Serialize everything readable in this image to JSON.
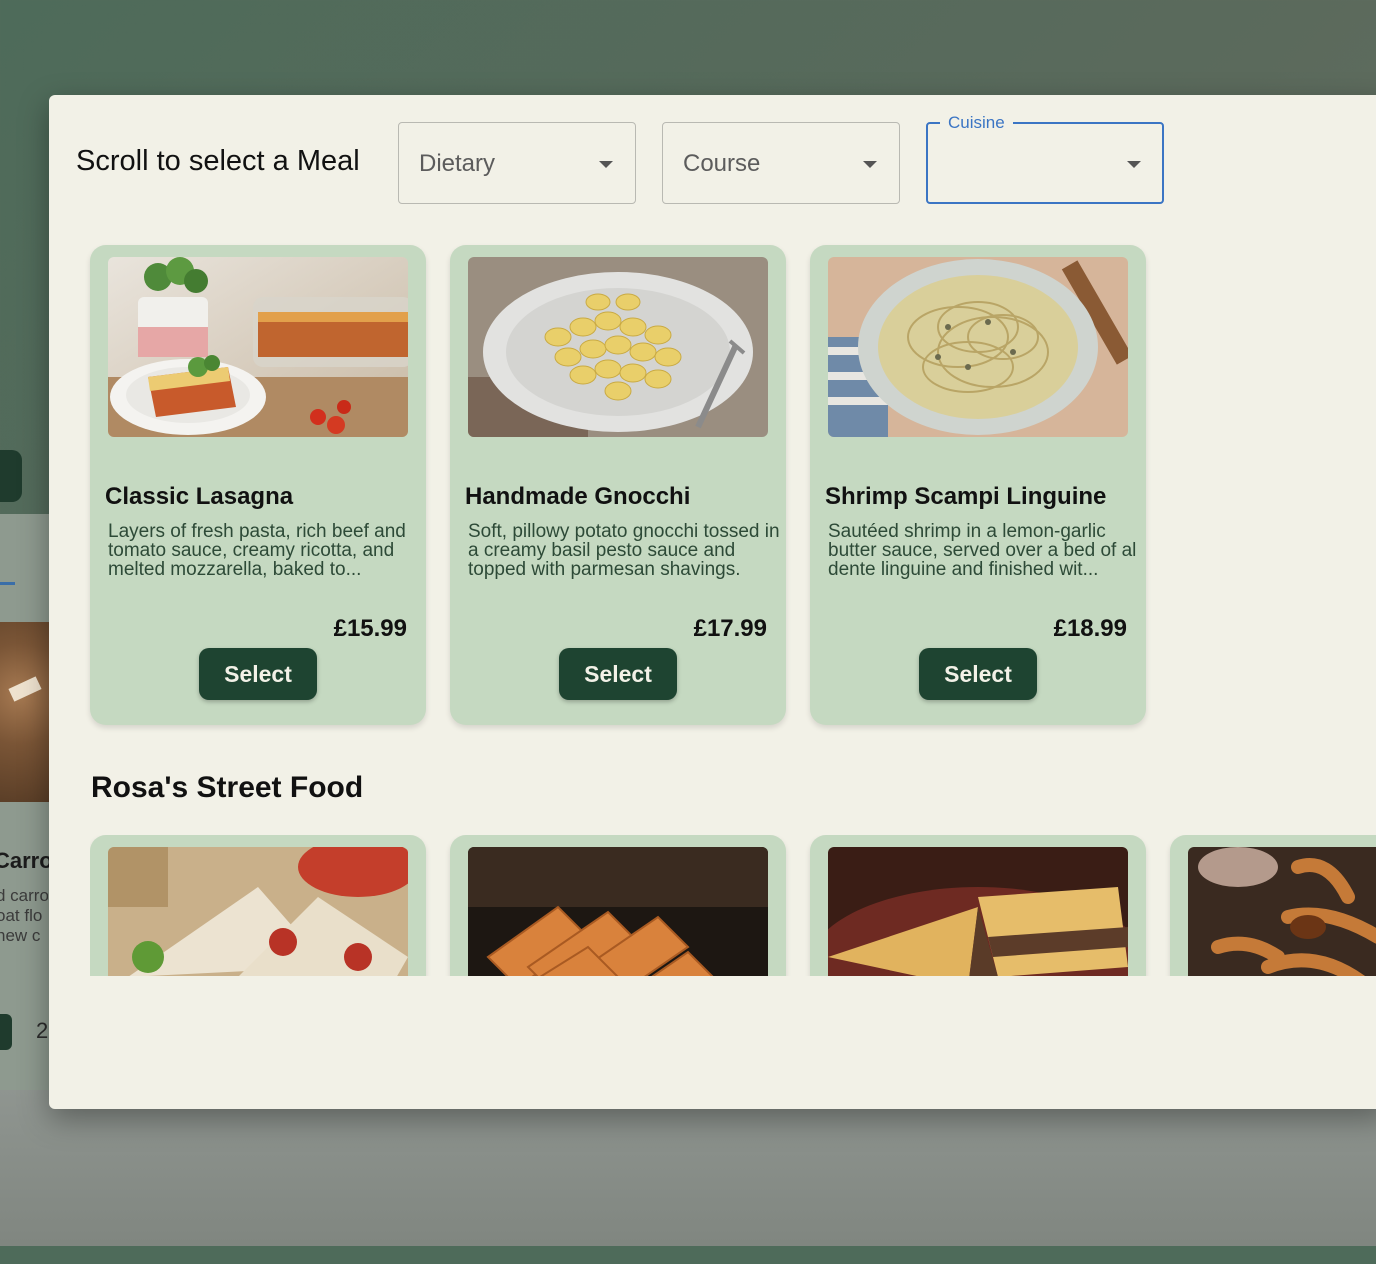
{
  "background": {
    "card_title_fragment": "Carro",
    "card_desc_lines": [
      "d carro",
      "oat flo",
      "hew c"
    ],
    "pagination_fragment": "2"
  },
  "modal": {
    "title": "Scroll to select a Meal",
    "filters": {
      "dietary": {
        "placeholder": "Dietary"
      },
      "course": {
        "placeholder": "Course"
      },
      "cuisine": {
        "label": "Cuisine",
        "value": ""
      }
    },
    "meals": [
      {
        "name": "Classic Lasagna",
        "description": "Layers of fresh pasta, rich beef and tomato sauce, creamy ricotta, and melted mozzarella, baked to...",
        "price": "£15.99",
        "button": "Select"
      },
      {
        "name": "Handmade Gnocchi",
        "description": "Soft, pillowy potato gnocchi tossed in a creamy basil pesto sauce and topped with parmesan shavings.",
        "price": "£17.99",
        "button": "Select"
      },
      {
        "name": "Shrimp Scampi Linguine",
        "description": "Sautéed shrimp in a lemon-garlic butter sauce, served over a bed of al dente linguine and finished wit...",
        "price": "£18.99",
        "button": "Select"
      }
    ],
    "section2": {
      "title": "Rosa's Street Food"
    }
  },
  "colors": {
    "modal_bg": "#f2f1e7",
    "card_bg": "#c5d9c1",
    "button_bg": "#1e4431",
    "focus_blue": "#3b75c4"
  }
}
